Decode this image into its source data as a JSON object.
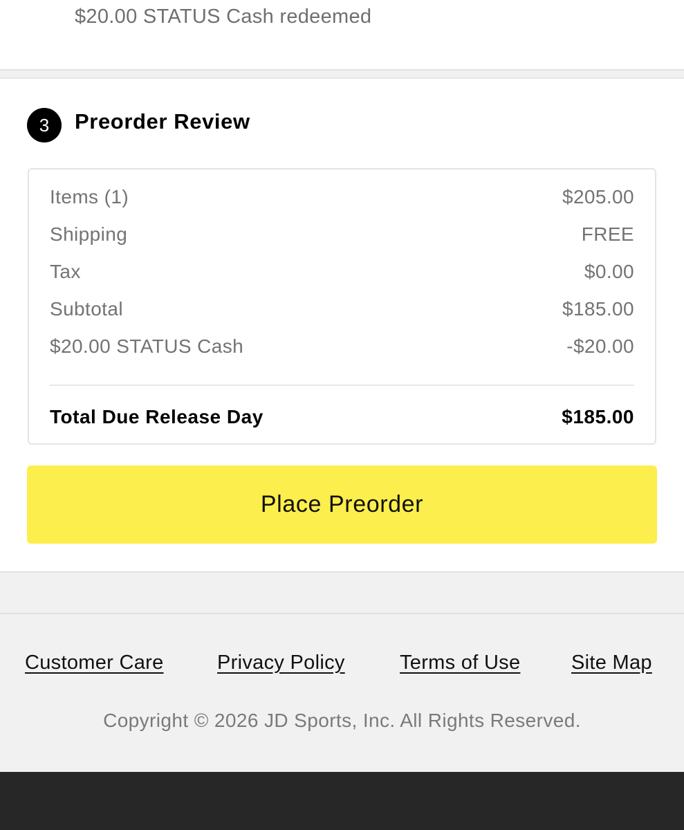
{
  "top": {
    "redeemed_text": "$20.00 STATUS Cash redeemed"
  },
  "review": {
    "step_number": "3",
    "title": "Preorder Review",
    "rows": [
      {
        "label": "Items (1)",
        "value": "$205.00"
      },
      {
        "label": "Shipping",
        "value": "FREE"
      },
      {
        "label": "Tax",
        "value": "$0.00"
      },
      {
        "label": "Subtotal",
        "value": "$185.00"
      },
      {
        "label": "$20.00 STATUS Cash",
        "value": "-$20.00"
      }
    ],
    "total": {
      "label": "Total Due Release Day",
      "value": "$185.00"
    },
    "place_button_label": "Place Preorder"
  },
  "footer": {
    "links": [
      {
        "label": "Customer Care"
      },
      {
        "label": "Privacy Policy"
      },
      {
        "label": "Terms of Use"
      },
      {
        "label": "Site Map"
      }
    ],
    "copyright": "Copyright © 2026 JD Sports, Inc. All Rights Reserved."
  },
  "colors": {
    "button_yellow": "#fcee4c",
    "bottom_bar": "#272727",
    "footer_bg": "#f1f1f1"
  }
}
